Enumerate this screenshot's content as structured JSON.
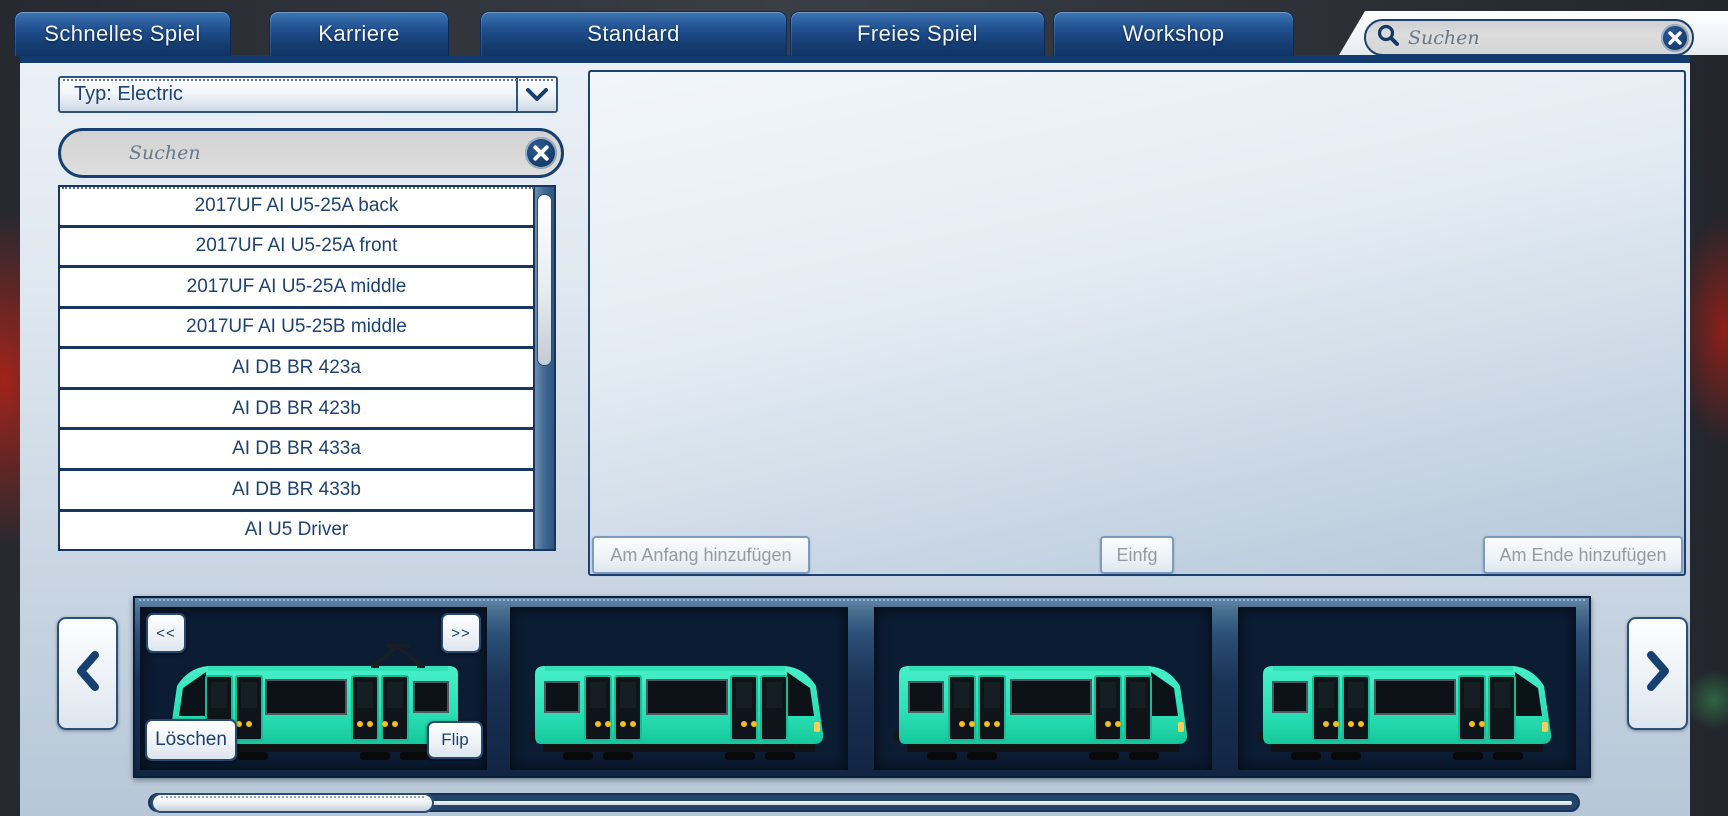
{
  "colors": {
    "accent_navy": "#17406f",
    "tab_blue": "#1b4a85",
    "train_teal": "#2fe3ba",
    "panel_light": "#dfe7f0",
    "strip_navy": "#0c1c33",
    "disabled_text": "#939ba4"
  },
  "tab_bar": {
    "tabs": [
      {
        "label": "Schnelles Spiel"
      },
      {
        "label": "Karriere"
      },
      {
        "label": "Standard"
      },
      {
        "label": "Freies Spiel"
      },
      {
        "label": "Workshop"
      }
    ],
    "search": {
      "placeholder": "Suchen",
      "search_icon": "magnifier-icon",
      "clear_icon": "x-circle-icon"
    }
  },
  "left_panel": {
    "type_dropdown": {
      "value": "Typ: Electric",
      "chevron_icon": "chevron-down-icon"
    },
    "search": {
      "placeholder": "Suchen",
      "clear_icon": "x-circle-icon"
    },
    "vehicle_list": [
      "2017UF AI U5-25A back",
      "2017UF AI U5-25A front",
      "2017UF AI U5-25A middle",
      "2017UF AI U5-25B middle",
      "AI DB BR 423a",
      "AI DB BR 423b",
      "AI DB BR 433a",
      "AI DB BR 433b",
      "AI U5 Driver"
    ]
  },
  "consist_panel": {
    "add_start_label": "Am Anfang hinzufügen",
    "insert_label": "Einfg",
    "add_end_label": "Am Ende hinzufügen"
  },
  "train_strip": {
    "move_left_label": "<<",
    "move_right_label": ">>",
    "delete_label": "Löschen",
    "flip_label": "Flip",
    "scroll_left_icon": "chevron-left-icon",
    "scroll_right_icon": "chevron-right-icon",
    "cars": [
      {
        "facing": "left",
        "pantograph": true
      },
      {
        "facing": "right",
        "pantograph": false
      },
      {
        "facing": "right",
        "pantograph": false
      },
      {
        "facing": "right",
        "pantograph": false
      }
    ]
  }
}
